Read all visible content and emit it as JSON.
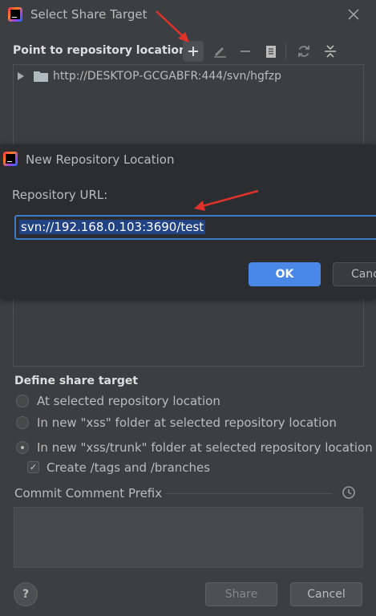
{
  "dialog": {
    "title": "Select Share Target",
    "point_label": "Point to repository location",
    "repo_tree_item": "http://DESKTOP-GCGABFR:444/svn/hgfzp",
    "define_label": "Define share target",
    "options": [
      {
        "label": "At selected repository location",
        "selected": false
      },
      {
        "label": "In new \"xss\" folder at selected repository location",
        "selected": false
      },
      {
        "label": "In new \"xss/trunk\" folder at selected repository location",
        "selected": true
      }
    ],
    "create_tags_label": "Create /tags and /branches",
    "create_tags_checked": true,
    "commit_prefix_label": "Commit Comment Prefix",
    "share_label": "Share",
    "cancel_label": "Cancel",
    "help_label": "?"
  },
  "popup": {
    "title": "New Repository Location",
    "url_label": "Repository URL:",
    "url_value": "svn://192.168.0.103:3690/test",
    "ok_label": "OK",
    "cancel_label": "Canc"
  },
  "colors": {
    "background": "#3c3f41",
    "popup_background": "#2b2d30",
    "accent": "#4a88e8",
    "annotation_arrow": "#e0312a"
  },
  "icons": [
    "add-icon",
    "edit-icon",
    "remove-icon",
    "copy-icon",
    "refresh-icon",
    "collapse-icon",
    "folder-icon",
    "expand-arrow-icon",
    "history-clock-icon",
    "close-icon",
    "intellij-logo-icon"
  ]
}
